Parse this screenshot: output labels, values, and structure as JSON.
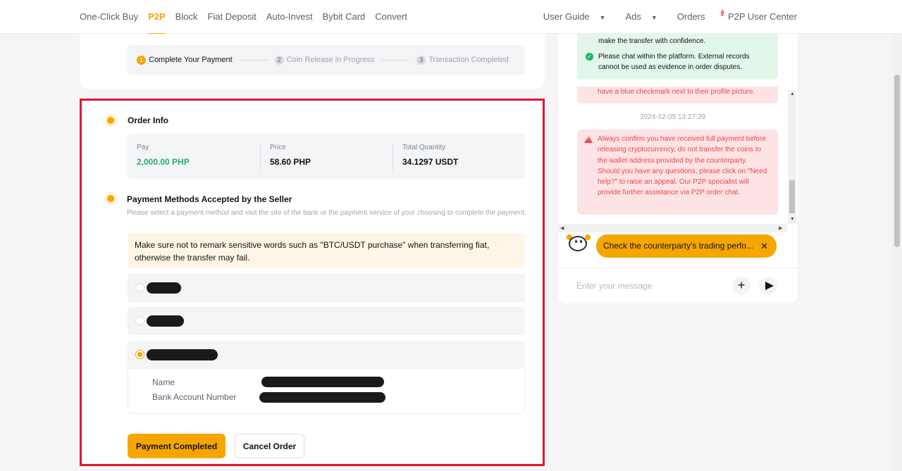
{
  "nav": {
    "left": [
      "One-Click Buy",
      "P2P",
      "Block",
      "Fiat Deposit",
      "Auto-Invest",
      "Bybit Card",
      "Convert"
    ],
    "active": "P2P",
    "user_guide": "User Guide",
    "ads": "Ads",
    "orders": "Orders",
    "orders_badge": "1",
    "user_center": "P2P User Center"
  },
  "steps": [
    {
      "num": "1",
      "label": "Complete Your Payment",
      "active": true
    },
    {
      "num": "2",
      "label": "Coin Release in Progress",
      "active": false
    },
    {
      "num": "3",
      "label": "Transaction Completed",
      "active": false
    }
  ],
  "order_info": {
    "title": "Order Info",
    "pay_label": "Pay",
    "pay_value": "2,000.00 PHP",
    "price_label": "Price",
    "price_value": "58.60 PHP",
    "qty_label": "Total Quantity",
    "qty_value": "34.1297 USDT"
  },
  "payment": {
    "title": "Payment Methods Accepted by the Seller",
    "description": "Please select a payment method and visit the site of the bank or the payment service of your choosing to complete the payment.",
    "warning": "Make sure not to remark sensitive words such as \"BTC/USDT purchase\" when transferring fiat, otherwise the transfer may fail.",
    "name_label": "Name",
    "account_label": "Bank Account Number",
    "selected_index": 2
  },
  "buttons": {
    "completed": "Payment Completed",
    "cancel": "Cancel Order"
  },
  "chat": {
    "green_line1": "make the transfer with confidence.",
    "green_line2": "Please chat within the platform. External records cannot be used as evidence in order disputes.",
    "pink_top": "have a blue checkmark next to their profile picture.",
    "timestamp": "2024-12-05 13:27:39",
    "warning": "Always confirm you have received full payment before releasing cryptocurrency, do not transfer the coins to the wallet address provided by the counterparty. Should you have any questions, please click on \"Need help?\" to raise an appeal. Our P2P specialist will provide further assistance via P2P order chat.",
    "pill": "Check the counterparty's trading perfo...",
    "placeholder": "Enter your message"
  },
  "colors": {
    "accent": "#f7a600",
    "green": "#20b26c",
    "red": "#ef454a",
    "highlight_border": "#e4162e"
  }
}
